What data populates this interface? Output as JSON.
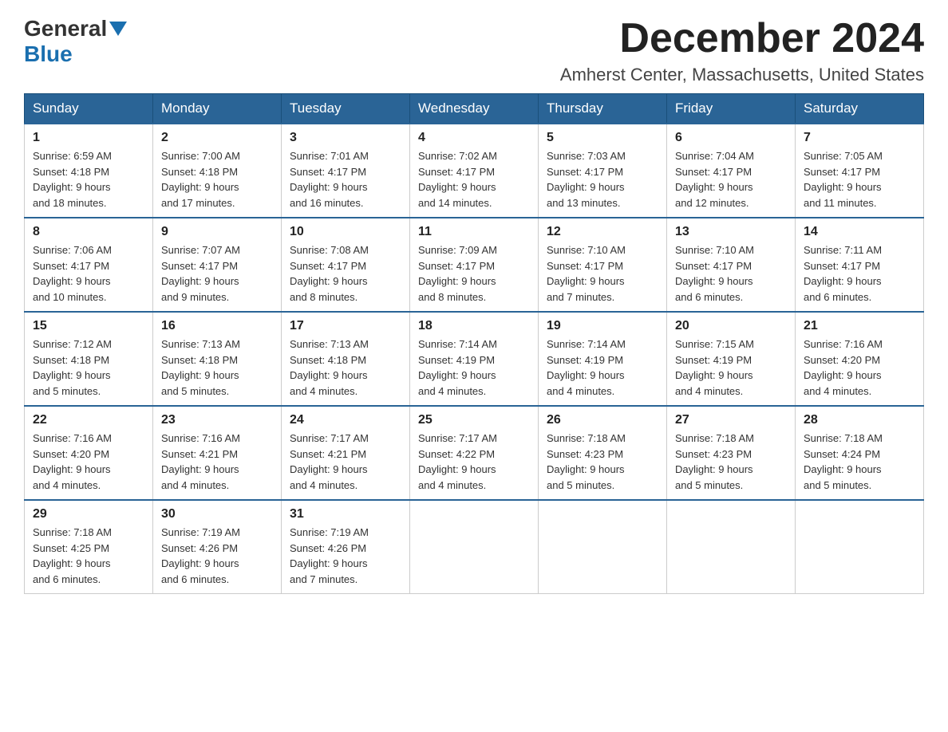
{
  "header": {
    "title": "December 2024",
    "location": "Amherst Center, Massachusetts, United States",
    "logo_general": "General",
    "logo_blue": "Blue"
  },
  "days_of_week": [
    "Sunday",
    "Monday",
    "Tuesday",
    "Wednesday",
    "Thursday",
    "Friday",
    "Saturday"
  ],
  "weeks": [
    [
      {
        "day": "1",
        "sunrise": "6:59 AM",
        "sunset": "4:18 PM",
        "daylight": "9 hours and 18 minutes."
      },
      {
        "day": "2",
        "sunrise": "7:00 AM",
        "sunset": "4:18 PM",
        "daylight": "9 hours and 17 minutes."
      },
      {
        "day": "3",
        "sunrise": "7:01 AM",
        "sunset": "4:17 PM",
        "daylight": "9 hours and 16 minutes."
      },
      {
        "day": "4",
        "sunrise": "7:02 AM",
        "sunset": "4:17 PM",
        "daylight": "9 hours and 14 minutes."
      },
      {
        "day": "5",
        "sunrise": "7:03 AM",
        "sunset": "4:17 PM",
        "daylight": "9 hours and 13 minutes."
      },
      {
        "day": "6",
        "sunrise": "7:04 AM",
        "sunset": "4:17 PM",
        "daylight": "9 hours and 12 minutes."
      },
      {
        "day": "7",
        "sunrise": "7:05 AM",
        "sunset": "4:17 PM",
        "daylight": "9 hours and 11 minutes."
      }
    ],
    [
      {
        "day": "8",
        "sunrise": "7:06 AM",
        "sunset": "4:17 PM",
        "daylight": "9 hours and 10 minutes."
      },
      {
        "day": "9",
        "sunrise": "7:07 AM",
        "sunset": "4:17 PM",
        "daylight": "9 hours and 9 minutes."
      },
      {
        "day": "10",
        "sunrise": "7:08 AM",
        "sunset": "4:17 PM",
        "daylight": "9 hours and 8 minutes."
      },
      {
        "day": "11",
        "sunrise": "7:09 AM",
        "sunset": "4:17 PM",
        "daylight": "9 hours and 8 minutes."
      },
      {
        "day": "12",
        "sunrise": "7:10 AM",
        "sunset": "4:17 PM",
        "daylight": "9 hours and 7 minutes."
      },
      {
        "day": "13",
        "sunrise": "7:10 AM",
        "sunset": "4:17 PM",
        "daylight": "9 hours and 6 minutes."
      },
      {
        "day": "14",
        "sunrise": "7:11 AM",
        "sunset": "4:17 PM",
        "daylight": "9 hours and 6 minutes."
      }
    ],
    [
      {
        "day": "15",
        "sunrise": "7:12 AM",
        "sunset": "4:18 PM",
        "daylight": "9 hours and 5 minutes."
      },
      {
        "day": "16",
        "sunrise": "7:13 AM",
        "sunset": "4:18 PM",
        "daylight": "9 hours and 5 minutes."
      },
      {
        "day": "17",
        "sunrise": "7:13 AM",
        "sunset": "4:18 PM",
        "daylight": "9 hours and 4 minutes."
      },
      {
        "day": "18",
        "sunrise": "7:14 AM",
        "sunset": "4:19 PM",
        "daylight": "9 hours and 4 minutes."
      },
      {
        "day": "19",
        "sunrise": "7:14 AM",
        "sunset": "4:19 PM",
        "daylight": "9 hours and 4 minutes."
      },
      {
        "day": "20",
        "sunrise": "7:15 AM",
        "sunset": "4:19 PM",
        "daylight": "9 hours and 4 minutes."
      },
      {
        "day": "21",
        "sunrise": "7:16 AM",
        "sunset": "4:20 PM",
        "daylight": "9 hours and 4 minutes."
      }
    ],
    [
      {
        "day": "22",
        "sunrise": "7:16 AM",
        "sunset": "4:20 PM",
        "daylight": "9 hours and 4 minutes."
      },
      {
        "day": "23",
        "sunrise": "7:16 AM",
        "sunset": "4:21 PM",
        "daylight": "9 hours and 4 minutes."
      },
      {
        "day": "24",
        "sunrise": "7:17 AM",
        "sunset": "4:21 PM",
        "daylight": "9 hours and 4 minutes."
      },
      {
        "day": "25",
        "sunrise": "7:17 AM",
        "sunset": "4:22 PM",
        "daylight": "9 hours and 4 minutes."
      },
      {
        "day": "26",
        "sunrise": "7:18 AM",
        "sunset": "4:23 PM",
        "daylight": "9 hours and 5 minutes."
      },
      {
        "day": "27",
        "sunrise": "7:18 AM",
        "sunset": "4:23 PM",
        "daylight": "9 hours and 5 minutes."
      },
      {
        "day": "28",
        "sunrise": "7:18 AM",
        "sunset": "4:24 PM",
        "daylight": "9 hours and 5 minutes."
      }
    ],
    [
      {
        "day": "29",
        "sunrise": "7:18 AM",
        "sunset": "4:25 PM",
        "daylight": "9 hours and 6 minutes."
      },
      {
        "day": "30",
        "sunrise": "7:19 AM",
        "sunset": "4:26 PM",
        "daylight": "9 hours and 6 minutes."
      },
      {
        "day": "31",
        "sunrise": "7:19 AM",
        "sunset": "4:26 PM",
        "daylight": "9 hours and 7 minutes."
      },
      null,
      null,
      null,
      null
    ]
  ],
  "labels": {
    "sunrise": "Sunrise:",
    "sunset": "Sunset:",
    "daylight": "Daylight:"
  }
}
